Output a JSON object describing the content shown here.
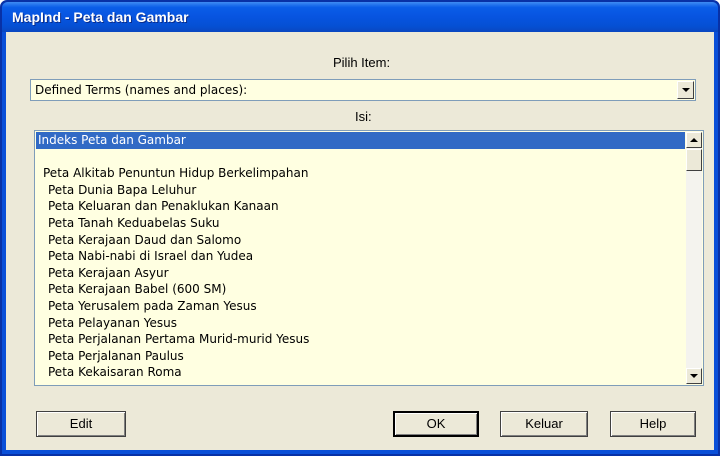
{
  "window": {
    "title": "MapInd - Peta dan Gambar"
  },
  "labels": {
    "pilih_item": "Pilih Item:",
    "isi": "Isi:"
  },
  "combo": {
    "value": "Defined Terms (names and places):"
  },
  "list": {
    "items": [
      "Indeks Peta dan Gambar",
      "",
      "Peta Alkitab Penuntun Hidup Berkelimpahan",
      "Peta Dunia Bapa Leluhur",
      "Peta Keluaran dan Penaklukan Kanaan",
      "Peta Tanah Keduabelas Suku",
      "Peta Kerajaan Daud dan Salomo",
      "Peta Nabi-nabi di Israel dan Yudea",
      "Peta Kerajaan Asyur",
      "Peta Kerajaan Babel (600 SM)",
      "Peta Yerusalem pada Zaman Yesus",
      "Peta Pelayanan Yesus",
      "Peta Perjalanan Pertama Murid-murid Yesus",
      "Peta Perjalanan Paulus",
      "Peta Kekaisaran Roma"
    ],
    "selected_index": 0
  },
  "buttons": {
    "edit": "Edit",
    "ok": "OK",
    "keluar": "Keluar",
    "help": "Help"
  }
}
